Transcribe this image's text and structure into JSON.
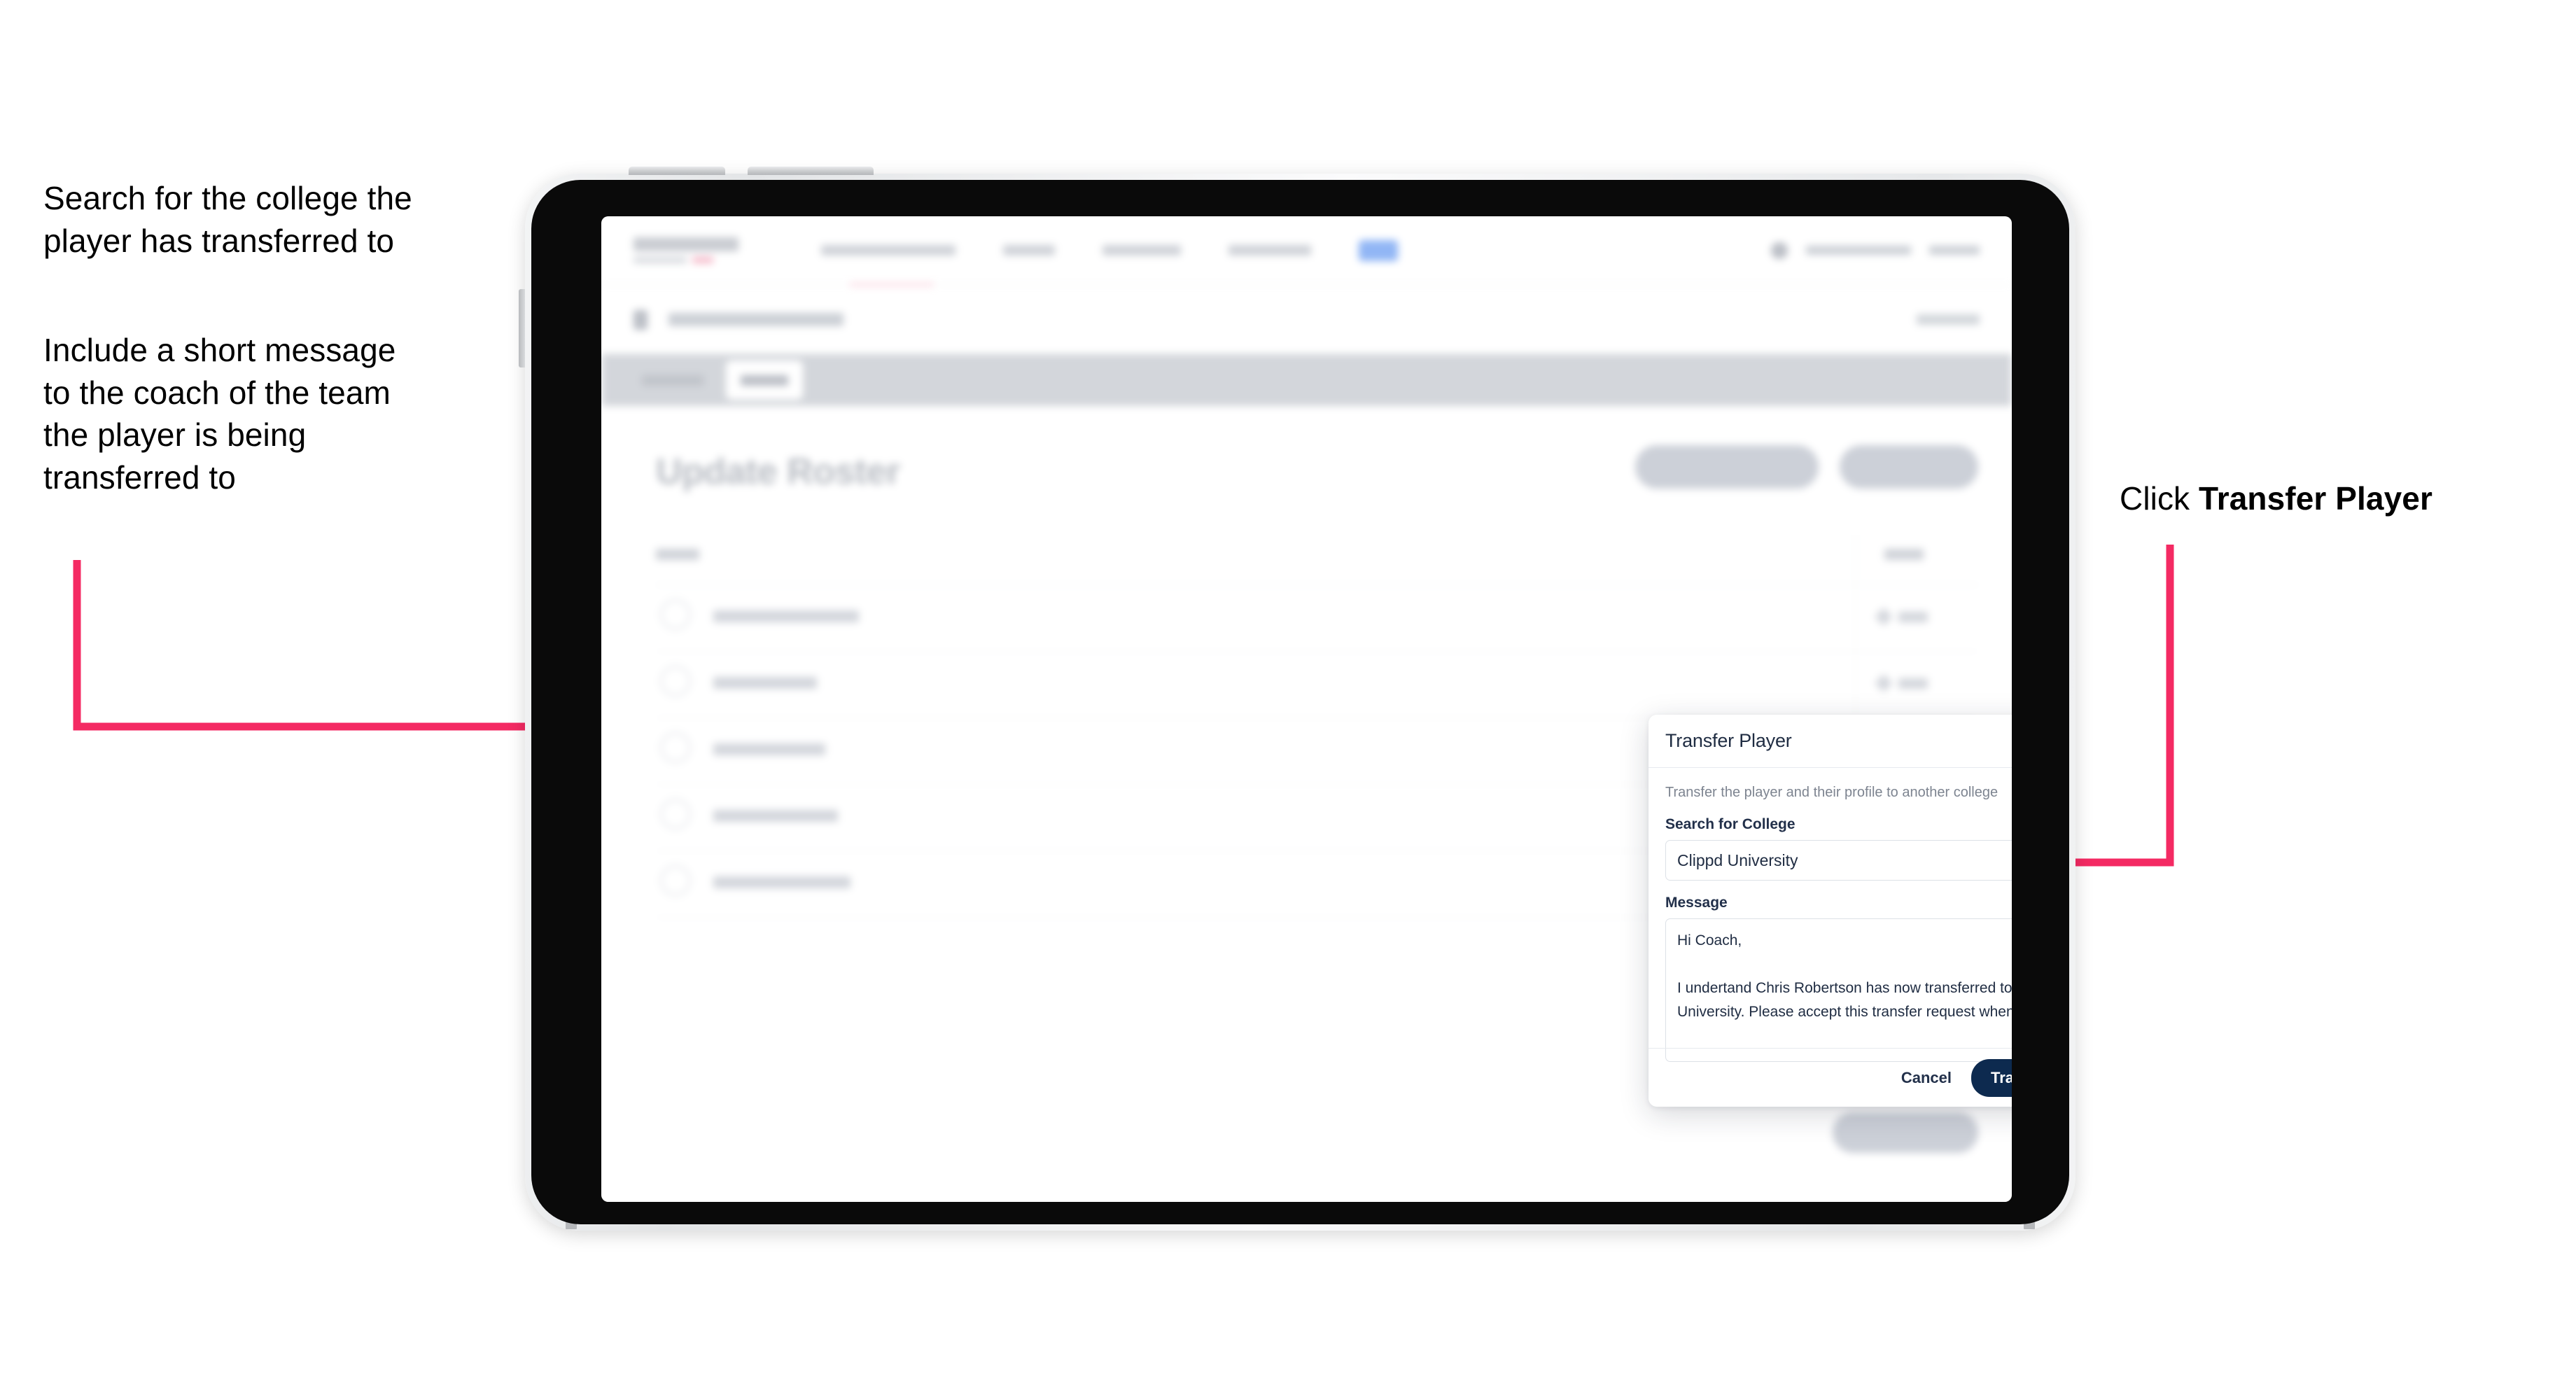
{
  "annotations": {
    "left_note_1": "Search for the college the\nplayer has transferred to",
    "left_note_2": "Include a short message\nto the coach of the team\nthe player is being\ntransferred to",
    "right_note_prefix": "Click ",
    "right_note_bold": "Transfer Player",
    "arrow_color": "#f42a63"
  },
  "modal": {
    "title": "Transfer Player",
    "close_icon": "close-icon",
    "subtitle": "Transfer the player and their profile to another college",
    "college_field": {
      "label": "Search for College",
      "value": "Clippd University",
      "placeholder": "Search for College"
    },
    "message_field": {
      "label": "Message",
      "value": "Hi Coach,\n\nI undertand Chris Robertson has now transferred to Clippd University. Please accept this transfer request when you can.",
      "placeholder": "Message"
    },
    "cancel_label": "Cancel",
    "submit_label": "Transfer Player",
    "submit_color": "#0d2a4f"
  },
  "app": {
    "page_title": "Update Roster",
    "brand_accent": "#f5b8c8",
    "nav_pill_color": "#8fb5f5"
  }
}
